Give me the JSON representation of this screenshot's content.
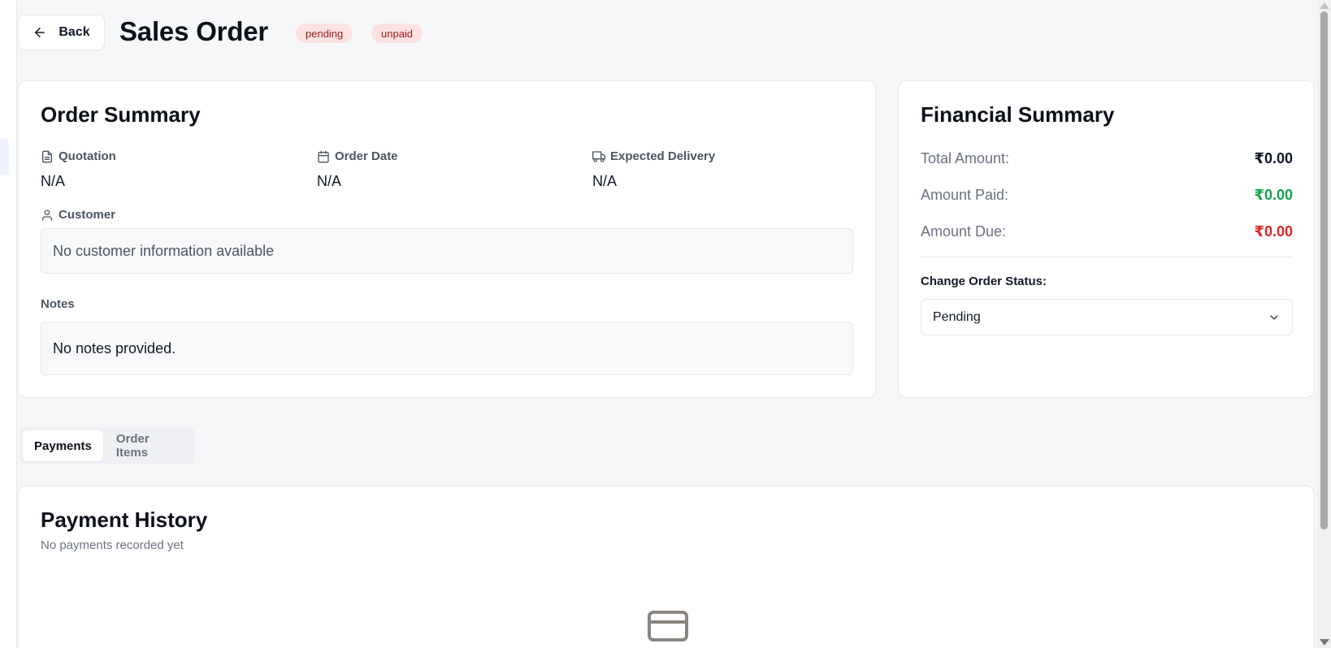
{
  "header": {
    "back_label": "Back",
    "title": "Sales Order",
    "badges": [
      "pending",
      "unpaid"
    ]
  },
  "order_summary": {
    "title": "Order Summary",
    "fields": [
      {
        "label": "Quotation",
        "value": "N/A",
        "icon": "file-text-icon"
      },
      {
        "label": "Order Date",
        "value": "N/A",
        "icon": "calendar-icon"
      },
      {
        "label": "Expected Delivery",
        "value": "N/A",
        "icon": "truck-icon"
      }
    ],
    "customer_label": "Customer",
    "customer_value": "No customer information available",
    "notes_label": "Notes",
    "notes_value": "No notes provided."
  },
  "financial_summary": {
    "title": "Financial Summary",
    "rows": [
      {
        "label": "Total Amount:",
        "value": "₹0.00",
        "color": "#111827"
      },
      {
        "label": "Amount Paid:",
        "value": "₹0.00",
        "color": "#16a34a"
      },
      {
        "label": "Amount Due:",
        "value": "₹0.00",
        "color": "#dc2626"
      }
    ],
    "status_label": "Change Order Status:",
    "status_value": "Pending"
  },
  "tabs": [
    {
      "label": "Payments",
      "active": true
    },
    {
      "label": "Order Items",
      "active": false
    }
  ],
  "payment_history": {
    "title": "Payment History",
    "subtitle": "No payments recorded yet",
    "empty_icon": "credit-card-icon"
  }
}
